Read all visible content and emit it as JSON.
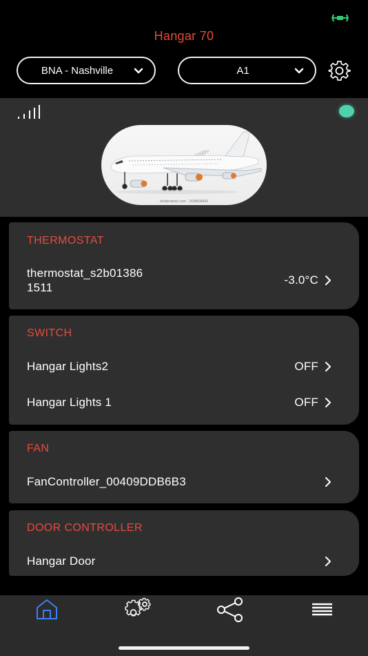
{
  "header": {
    "title": "Hangar 70",
    "airport_select": {
      "value": "BNA - Nashville"
    },
    "hangar_select": {
      "value": "A1"
    }
  },
  "hero": {
    "signal": "signal-bars-icon",
    "status_color": "#4fd1b0",
    "image_watermark": "shutterstock.com · 1638658942"
  },
  "sections": {
    "thermostat": {
      "title": "THERMOSTAT",
      "device": {
        "name_line1": "thermostat_s2b01386",
        "name_line2": "1511",
        "value": "-3.0°C"
      }
    },
    "switch": {
      "title": "SWITCH",
      "devices": [
        {
          "name": "Hangar Lights2",
          "value": "OFF"
        },
        {
          "name": "Hangar Lights 1",
          "value": "OFF"
        }
      ]
    },
    "fan": {
      "title": "FAN",
      "device": {
        "name": "FanController_00409DDB6B3",
        "value": ""
      }
    },
    "door": {
      "title": "DOOR CONTROLLER",
      "device": {
        "name": "Hangar Door",
        "value": ""
      }
    }
  },
  "tabbar": {
    "tabs": [
      "home-icon",
      "settings-gears-icon",
      "share-icon",
      "menu-icon"
    ],
    "active_color": "#3b82f6"
  },
  "colors": {
    "accent": "#e74c3c",
    "card": "#2f2f2f",
    "battery": "#2ecc71"
  }
}
